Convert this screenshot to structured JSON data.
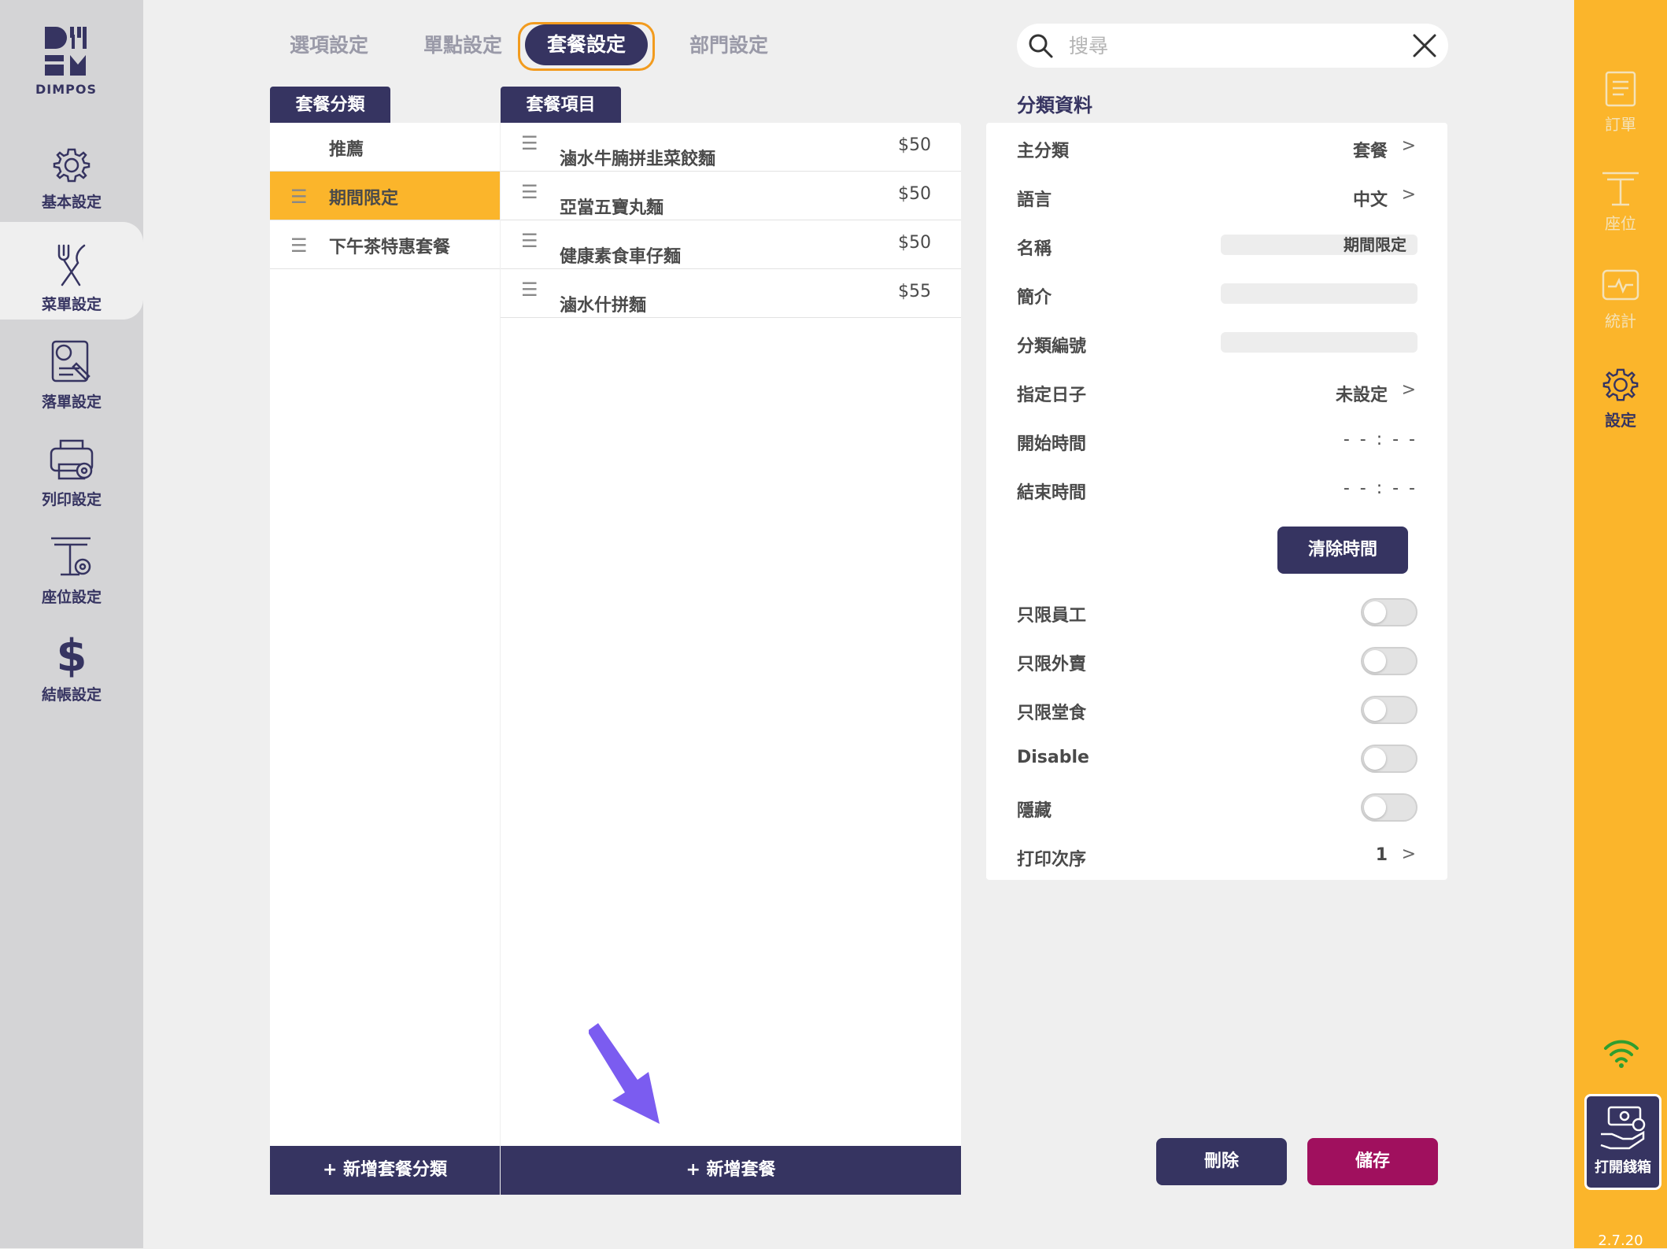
{
  "app": {
    "logo_text": "DIMPOS",
    "version": "2.7.20"
  },
  "left_nav": [
    {
      "label": "基本設定",
      "icon": "gear-icon"
    },
    {
      "label": "菜單設定",
      "icon": "fork-knife-icon"
    },
    {
      "label": "落單設定",
      "icon": "order-settings-icon"
    },
    {
      "label": "列印設定",
      "icon": "printer-icon"
    },
    {
      "label": "座位設定",
      "icon": "table-icon"
    },
    {
      "label": "結帳設定",
      "icon": "dollar-icon"
    }
  ],
  "tabs": [
    {
      "label": "選項設定"
    },
    {
      "label": "單點設定"
    },
    {
      "label": "套餐設定"
    },
    {
      "label": "部門設定"
    }
  ],
  "search": {
    "placeholder": "搜尋"
  },
  "categories": {
    "header": "套餐分類",
    "items": [
      {
        "name": "推薦"
      },
      {
        "name": "期間限定"
      },
      {
        "name": "下午茶特惠套餐"
      }
    ],
    "add_label": "+ 新增套餐分類"
  },
  "set_items": {
    "header": "套餐項目",
    "items": [
      {
        "name": "滷水牛腩拼韭菜餃麵",
        "price": "$50"
      },
      {
        "name": "亞當五寶丸麵",
        "price": "$50"
      },
      {
        "name": "健康素食車仔麵",
        "price": "$50"
      },
      {
        "name": "滷水什拼麵",
        "price": "$55"
      }
    ],
    "add_label": "+ 新增套餐"
  },
  "details": {
    "title": "分類資料",
    "main_category": {
      "label": "主分類",
      "value": "套餐"
    },
    "language": {
      "label": "語言",
      "value": "中文"
    },
    "name": {
      "label": "名稱",
      "value": "期間限定"
    },
    "intro": {
      "label": "簡介",
      "value": ""
    },
    "code": {
      "label": "分類編號",
      "value": ""
    },
    "day": {
      "label": "指定日子",
      "value": "未設定"
    },
    "start_time": {
      "label": "開始時間",
      "value": "- - : - -"
    },
    "end_time": {
      "label": "結束時間",
      "value": "- - : - -"
    },
    "clear_time_label": "清除時間",
    "staff_only": {
      "label": "只限員工"
    },
    "takeaway_only": {
      "label": "只限外賣"
    },
    "dinein_only": {
      "label": "只限堂食"
    },
    "disable": {
      "label": "Disable"
    },
    "hidden": {
      "label": "隱藏"
    },
    "print_order": {
      "label": "打印次序",
      "value": "1"
    }
  },
  "actions": {
    "delete_label": "刪除",
    "save_label": "儲存"
  },
  "right_nav": [
    {
      "label": "訂單",
      "icon": "receipt-icon"
    },
    {
      "label": "座位",
      "icon": "table-icon"
    },
    {
      "label": "統計",
      "icon": "stats-icon"
    },
    {
      "label": "設定",
      "icon": "gear-icon"
    }
  ],
  "cash_drawer_label": "打開錢箱",
  "colors": {
    "navy": "#363461",
    "accent": "#fbb52b",
    "save": "#a0105e",
    "focus": "#f29b1e"
  }
}
